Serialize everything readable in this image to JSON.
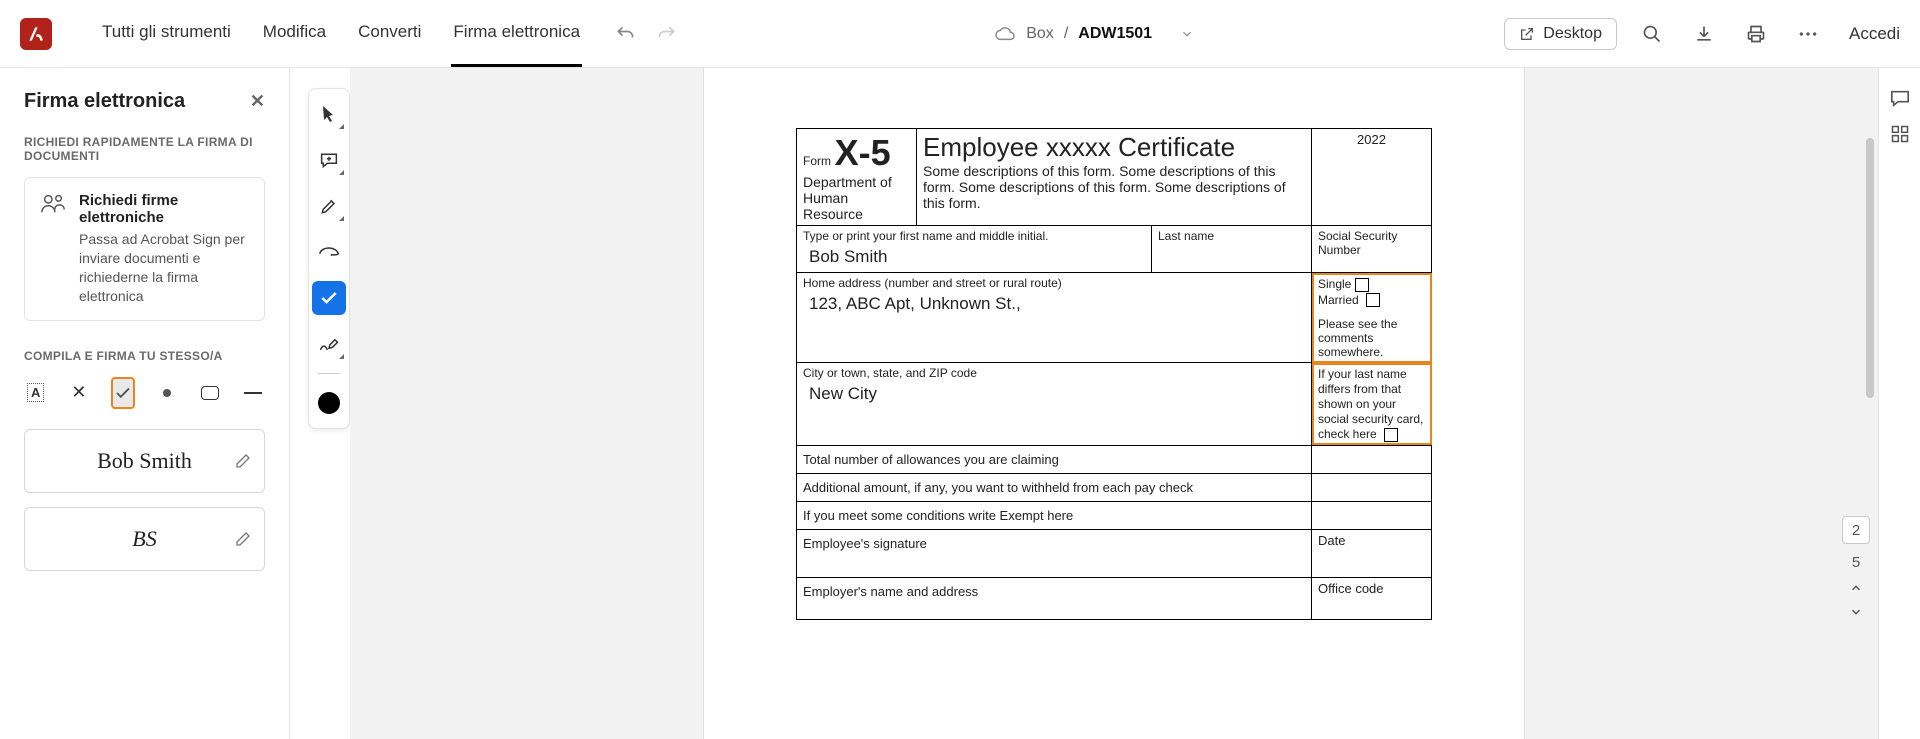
{
  "menu": {
    "m1": "Tutti gli strumenti",
    "m2": "Modifica",
    "m3": "Converti",
    "m4": "Firma elettronica"
  },
  "breadcrumb": {
    "source": "Box",
    "sep": "/",
    "file": "ADW1501"
  },
  "desktop": "Desktop",
  "signin": "Accedi",
  "panel": {
    "title": "Firma elettronica",
    "sec1": "RICHIEDI RAPIDAMENTE LA FIRMA DI DOCUMENTI",
    "promo_title": "Richiedi firme elettroniche",
    "promo_desc": "Passa ad Acrobat Sign per inviare documenti e richiederne la firma elettronica",
    "sec2": "COMPILA E FIRMA TU STESSO/A",
    "sig1": "Bob Smith",
    "sig2": "BS"
  },
  "form": {
    "form_label": "Form",
    "form_num": "X-5",
    "dept": "Department of\nHuman Resource",
    "title": "Employee xxxxx Certificate",
    "desc": "Some descriptions of this form. Some descriptions of this form. Some descriptions of this form. Some descriptions of this form.",
    "year": "2022",
    "r1a": "Type or print your first name and middle initial.",
    "r1a_v": "Bob Smith",
    "r1b": "Last name",
    "r1c": "Social Security Number",
    "r2a": "Home address (number and street or rural route)",
    "r2a_v": "123, ABC Apt, Unknown St.,",
    "single": "Single",
    "married": "Married",
    "r2note": "Please see the comments somewhere.",
    "r3a": "City or town, state, and ZIP code",
    "r3a_v": "New City",
    "r3b": "If your last name differs from that shown on your social security card, check here",
    "r4": "Total number of allowances you are claiming",
    "r5": "Additional amount, if any, you want to withheld from each pay check",
    "r6": "If you meet some conditions write Exempt here",
    "r7": "Employee's signature",
    "r7b": "Date",
    "r8": "Employer's name and address",
    "r8b": "Office code"
  },
  "pagenav": {
    "cur": "2",
    "total": "5"
  }
}
